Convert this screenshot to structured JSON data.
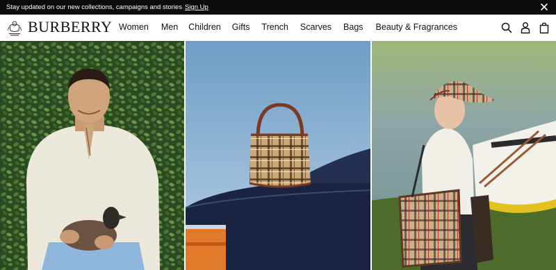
{
  "promo": {
    "text": "Stay updated on our new collections, campaigns and stories",
    "signup_label": "Sign Up",
    "close_icon": "close-icon"
  },
  "brand": {
    "name": "BURBERRY",
    "crest_icon": "royal-warrant-crest-icon"
  },
  "nav": {
    "items": [
      "Women",
      "Men",
      "Children",
      "Gifts",
      "Trench",
      "Scarves",
      "Bags",
      "Beauty & Fragrances"
    ]
  },
  "header_icons": [
    "search-icon",
    "account-icon",
    "shopping-bag-icon"
  ],
  "hero": {
    "panels": [
      {
        "name": "hero-image-men",
        "subject": "man-holding-duck"
      },
      {
        "name": "hero-image-bag",
        "subject": "check-bucket-bag-on-car"
      },
      {
        "name": "hero-image-women",
        "subject": "woman-with-check-hat-and-tote-by-boat"
      }
    ]
  },
  "colors": {
    "promo_bg": "#0b0b0b",
    "text": "#111111",
    "check_beige": "#c9a77a",
    "sky_blue": "#7fa7c9"
  }
}
